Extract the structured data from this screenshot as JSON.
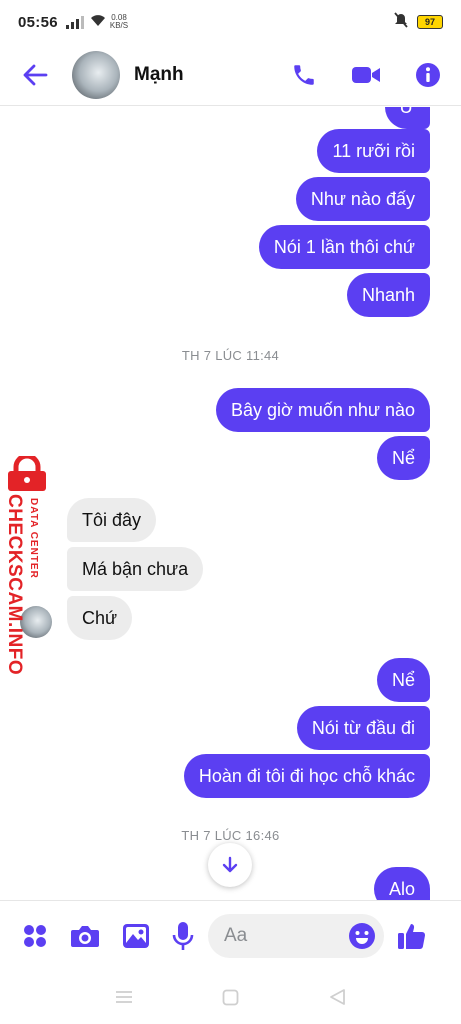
{
  "status_bar": {
    "time": "05:56",
    "speed_value": "0.08",
    "speed_unit": "KB/S",
    "battery": "97"
  },
  "header": {
    "contact_name": "Mạnh",
    "back_icon": "arrow-left-icon",
    "call_icon": "phone-icon",
    "video_icon": "video-camera-icon",
    "info_icon": "info-icon"
  },
  "colors": {
    "accent": "#5b3ff2",
    "incoming_bubble": "#ececec",
    "watermark": "#e32327"
  },
  "messages": {
    "partial": "Ừ",
    "out_1": "11 rưỡi rồi",
    "out_2": "Như nào đấy",
    "out_3": "Nói 1 lần thôi chứ",
    "out_4": "Nhanh",
    "timestamp_1": "TH 7 LÚC 11:44",
    "out_5": "Bây giờ muốn như nào",
    "out_6": "Nể",
    "in_1": "Tôi đây",
    "in_2": "Má bận chưa",
    "in_3": "Chứ",
    "out_7": "Nể",
    "out_8": "Nói từ đầu đi",
    "out_9": "Hoàn đi tôi đi học chỗ khác",
    "timestamp_2": "TH 7 LÚC 16:46",
    "out_10": "Alo"
  },
  "watermark": {
    "main": "CHECKSCAM.INFO",
    "sub": "DATA CENTER"
  },
  "composer": {
    "placeholder": "Aa",
    "icons": [
      "grid-dots-icon",
      "camera-icon",
      "image-icon",
      "microphone-icon",
      "emoji-icon",
      "thumbs-up-icon"
    ]
  },
  "nav_bar": {
    "icons": [
      "menu-icon",
      "home-square-icon",
      "back-triangle-icon"
    ]
  }
}
